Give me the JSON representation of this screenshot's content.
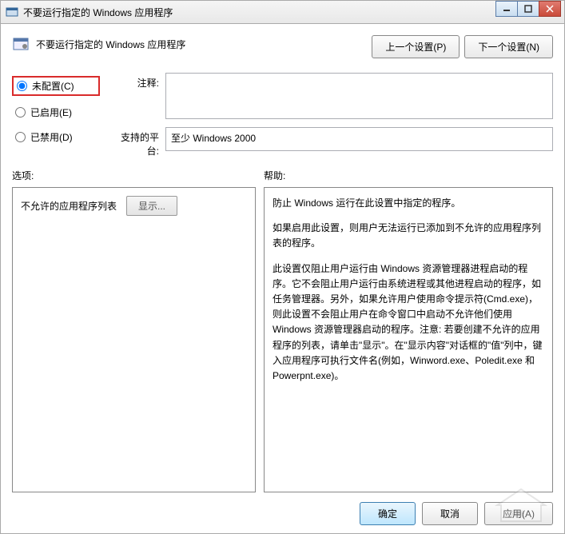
{
  "titlebar": {
    "title": "不要运行指定的 Windows 应用程序"
  },
  "header": {
    "title": "不要运行指定的 Windows 应用程序"
  },
  "nav": {
    "prev": "上一个设置(P)",
    "next": "下一个设置(N)"
  },
  "radios": {
    "not_configured": "未配置(C)",
    "enabled": "已启用(E)",
    "disabled": "已禁用(D)",
    "selected": "not_configured"
  },
  "fields": {
    "comment_label": "注释:",
    "comment_value": "",
    "platform_label": "支持的平台:",
    "platform_value": "至少 Windows 2000"
  },
  "sections": {
    "options_label": "选项:",
    "help_label": "帮助:"
  },
  "options": {
    "list_label": "不允许的应用程序列表",
    "show_button": "显示..."
  },
  "help": {
    "p1": "防止 Windows 运行在此设置中指定的程序。",
    "p2": "如果启用此设置，则用户无法运行已添加到不允许的应用程序列表的程序。",
    "p3": "此设置仅阻止用户运行由 Windows 资源管理器进程启动的程序。它不会阻止用户运行由系统进程或其他进程启动的程序，如任务管理器。另外，如果允许用户使用命令提示符(Cmd.exe)，则此设置不会阻止用户在命令窗口中启动不允许他们使用 Windows 资源管理器启动的程序。注意: 若要创建不允许的应用程序的列表，请单击\"显示\"。在\"显示内容\"对话框的\"值\"列中，键入应用程序可执行文件名(例如，Winword.exe、Poledit.exe 和 Powerpnt.exe)。"
  },
  "footer": {
    "ok": "确定",
    "cancel": "取消",
    "apply": "应用(A)"
  }
}
